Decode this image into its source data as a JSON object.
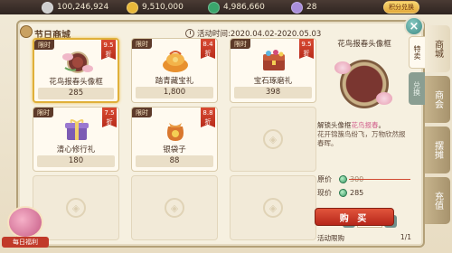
{
  "currencies": [
    {
      "icon": "silver-coin-icon",
      "value": "100,246,924",
      "color": "#c9c9c9"
    },
    {
      "icon": "gold-coin-icon",
      "value": "9,510,000",
      "color": "#e8b83a"
    },
    {
      "icon": "jade-currency-icon",
      "value": "4,986,660",
      "color": "#3aa56c"
    },
    {
      "icon": "energy-icon",
      "value": "28",
      "color": "#a98edb"
    }
  ],
  "topbar": {
    "points_exchange": "积分兑换"
  },
  "shop": {
    "title": "节日商城",
    "event_time": "活动时间:2020.04.02-2020.05.03"
  },
  "items": [
    {
      "tag": "限时",
      "discount_num": "9.5",
      "discount_unit": "折",
      "name": "花鸟报春头像框",
      "price": "285",
      "icon": "avatar-frame-icon"
    },
    {
      "tag": "限时",
      "discount_num": "8.4",
      "discount_unit": "折",
      "name": "踏青藏宝礼",
      "price": "1,800",
      "icon": "treasure-gift-icon"
    },
    {
      "tag": "限时",
      "discount_num": "9.5",
      "discount_unit": "折",
      "name": "宝石琢磨礼",
      "price": "398",
      "icon": "gem-chest-icon"
    },
    {
      "tag": "限时",
      "discount_num": "7.5",
      "discount_unit": "折",
      "name": "清心修行礼",
      "price": "180",
      "icon": "purple-gift-box-icon"
    },
    {
      "tag": "限时",
      "discount_num": "8.8",
      "discount_unit": "折",
      "name": "银袋子",
      "price": "88",
      "icon": "silver-pouch-icon"
    }
  ],
  "detail": {
    "title": "花鸟报春头像框",
    "unlock_prefix": "解锁头像框",
    "unlock_name": "花鸟报春",
    "unlock_suffix": "。",
    "flavor": "花开锦簇鸟纷飞，万物欣然报春晖。",
    "orig_label": "原价",
    "orig_price": "300",
    "now_label": "现价",
    "now_price": "285",
    "qty_label": "数量",
    "qty_value": "1",
    "limit_label": "活动限购",
    "limit_value": "1/1",
    "buy_label": "购 买"
  },
  "inner_tabs": [
    {
      "label": "特卖",
      "active": true
    },
    {
      "label": "兑换",
      "active": false
    }
  ],
  "side_tabs": [
    {
      "label": "商城",
      "active": true
    },
    {
      "label": "商会",
      "active": false
    },
    {
      "label": "摆摊",
      "active": false
    },
    {
      "label": "充值",
      "active": false
    }
  ],
  "daily_gift": {
    "label": "每日福利"
  }
}
